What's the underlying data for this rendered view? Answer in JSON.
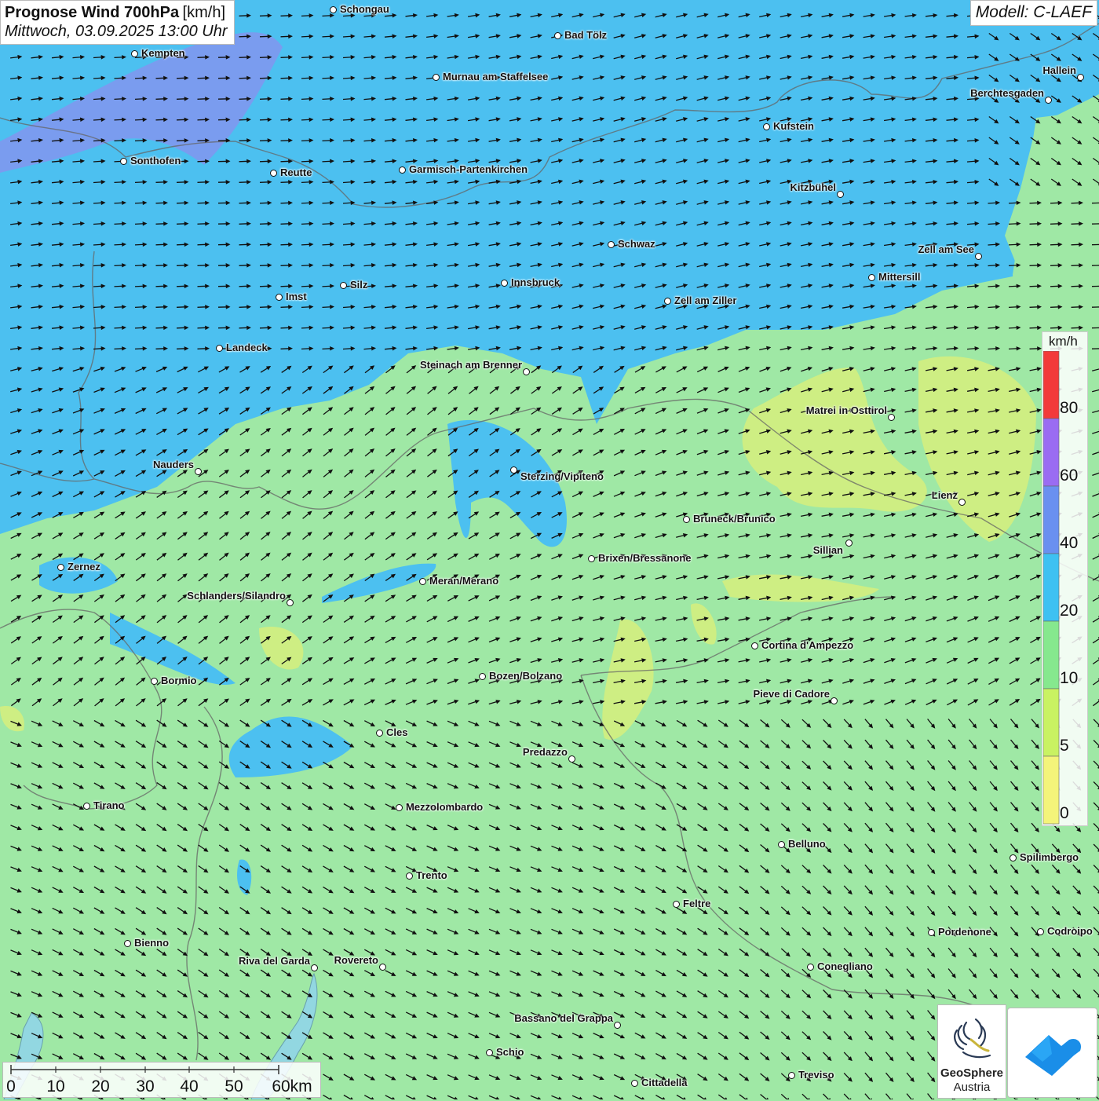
{
  "title": {
    "main": "Prognose Wind 700hPa",
    "unit": "[km/h]",
    "datetime": "Mittwoch, 03.09.2025 13:00 Uhr"
  },
  "model_label": "Modell: C-LAEF",
  "legend": {
    "unit": "km/h",
    "labels": [
      "80",
      "60",
      "40",
      "20",
      "10",
      "5",
      "0"
    ],
    "colors": [
      "#f23a3a",
      "#9a6cf2",
      "#6a90f0",
      "#3ec1f2",
      "#86e88e",
      "#c9f262",
      "#f4f47a"
    ]
  },
  "scale_bar": {
    "labels": [
      "0",
      "10",
      "20",
      "30",
      "40",
      "50",
      "60km"
    ]
  },
  "logos": {
    "geosphere_name": "GeoSphere",
    "geosphere_sub": "Austria"
  },
  "cities": [
    {
      "name": "Schongau"
    },
    {
      "name": "Bad Tölz"
    },
    {
      "name": "Kempten"
    },
    {
      "name": "Murnau am Staffelsee"
    },
    {
      "name": "Hallein"
    },
    {
      "name": "Berchtesgaden"
    },
    {
      "name": "Kufstein"
    },
    {
      "name": "Sonthofen"
    },
    {
      "name": "Reutte"
    },
    {
      "name": "Garmisch-Partenkirchen"
    },
    {
      "name": "Kitzbühel"
    },
    {
      "name": "Schwaz"
    },
    {
      "name": "Zell am See"
    },
    {
      "name": "Mittersill"
    },
    {
      "name": "Innsbruck"
    },
    {
      "name": "Silz"
    },
    {
      "name": "Imst"
    },
    {
      "name": "Zell am Ziller"
    },
    {
      "name": "Landeck"
    },
    {
      "name": "Steinach am Brenner"
    },
    {
      "name": "Matrei in Osttirol"
    },
    {
      "name": "Nauders"
    },
    {
      "name": "Sterzing/Vipiteno"
    },
    {
      "name": "Lienz"
    },
    {
      "name": "Bruneck/Brunico"
    },
    {
      "name": "Sillian"
    },
    {
      "name": "Brixen/Bressanone"
    },
    {
      "name": "Zernez"
    },
    {
      "name": "Meran/Merano"
    },
    {
      "name": "Schlanders/Silandro"
    },
    {
      "name": "Cortina d'Ampezzo"
    },
    {
      "name": "Bozen/Bolzano"
    },
    {
      "name": "Bormio"
    },
    {
      "name": "Pieve di Cadore"
    },
    {
      "name": "Cles"
    },
    {
      "name": "Predazzo"
    },
    {
      "name": "Tirano"
    },
    {
      "name": "Mezzolombardo"
    },
    {
      "name": "Belluno"
    },
    {
      "name": "Spilimbergo"
    },
    {
      "name": "Trento"
    },
    {
      "name": "Feltre"
    },
    {
      "name": "Pordenone"
    },
    {
      "name": "Codroipo"
    },
    {
      "name": "Bienno"
    },
    {
      "name": "Riva del Garda"
    },
    {
      "name": "Rovereto"
    },
    {
      "name": "Conegliano"
    },
    {
      "name": "Bassano del Grappa"
    },
    {
      "name": "Schio"
    },
    {
      "name": "Treviso"
    },
    {
      "name": "Cittadella"
    }
  ]
}
